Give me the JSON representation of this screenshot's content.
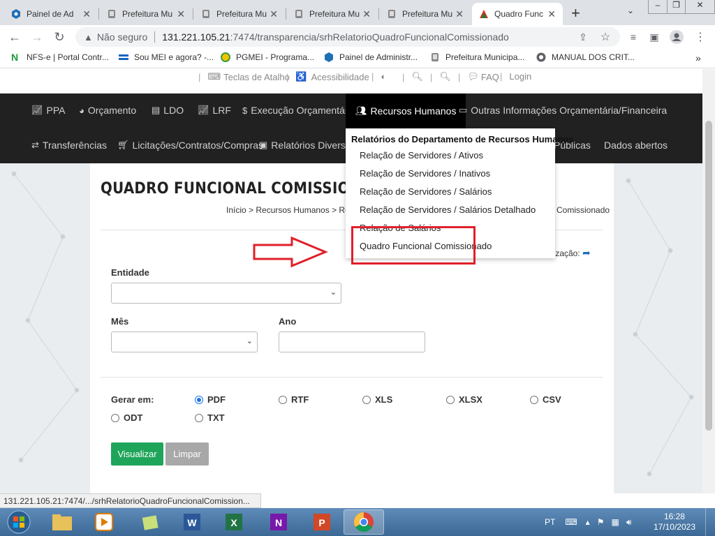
{
  "browser": {
    "tabs": [
      {
        "title": "Painel de Ad",
        "favicon": "painel-icon",
        "active": false
      },
      {
        "title": "Prefeitura Mu",
        "favicon": "prefeitura-icon",
        "active": false
      },
      {
        "title": "Prefeitura Mu",
        "favicon": "prefeitura-icon",
        "active": false
      },
      {
        "title": "Prefeitura Mu",
        "favicon": "prefeitura-icon",
        "active": false
      },
      {
        "title": "Prefeitura Mu",
        "favicon": "prefeitura-icon",
        "active": false
      },
      {
        "title": "Quadro Func",
        "favicon": "quadro-icon",
        "active": true
      }
    ],
    "new_tab_symbol": "+",
    "security_label": "Não seguro",
    "url_host": "131.221.105.21",
    "url_rest": ":7474/transparencia/srhRelatorioQuadroFuncionalComissionado",
    "bookmarks": [
      {
        "label": "NFS-e | Portal Contr...",
        "icon": "nfse-icon"
      },
      {
        "label": "Sou MEI e agora? -...",
        "icon": "mei-icon"
      },
      {
        "label": "PGMEI - Programa...",
        "icon": "pgmei-icon"
      },
      {
        "label": "Painel de Administr...",
        "icon": "painel-icon"
      },
      {
        "label": "Prefeitura Municipa...",
        "icon": "prefeitura-icon"
      },
      {
        "label": "MANUAL DOS CRIT...",
        "icon": "globe-icon"
      }
    ],
    "bookmarks_more": "»"
  },
  "site": {
    "topbar": {
      "shortcuts": "Teclas de Atalho",
      "accessibility": "Acessibilidade",
      "faq": "FAQ",
      "login": "Login"
    },
    "nav_row1": [
      {
        "label": "PPA",
        "icon": "chart-line-icon"
      },
      {
        "label": "Orçamento",
        "icon": "pie-chart-icon"
      },
      {
        "label": "LDO",
        "icon": "file-icon"
      },
      {
        "label": "LRF",
        "icon": "chart-line-icon"
      },
      {
        "label": "Execução Orçamentária",
        "icon": "dollar-icon"
      },
      {
        "label": "Recursos Humanos",
        "icon": "users-icon",
        "active": true
      },
      {
        "label": "Outras Informações Orçamentária/Financeira",
        "icon": "money-icon"
      }
    ],
    "nav_row2": [
      {
        "label": "Transferências",
        "icon": "exchange-icon"
      },
      {
        "label": "Licitações/Contratos/Compras",
        "icon": "cart-icon"
      },
      {
        "label": "Relatórios Diversos",
        "icon": "id-card-icon"
      },
      {
        "label": "Públicas",
        "icon": ""
      },
      {
        "label": "Dados abertos",
        "icon": ""
      }
    ],
    "dropdown": {
      "header": "Relatórios do Departamento de Recursos Humanos",
      "items": [
        "Relação de Servidores / Ativos",
        "Relação de Servidores / Inativos",
        "Relação de Servidores / Salários",
        "Relação de Servidores / Salários Detalhado",
        "Relação de Salários",
        "Quadro Funcional Comissionado"
      ]
    },
    "page_title": "QUADRO FUNCIONAL COMISSIONADO",
    "breadcrumb_left": "Início > Recursos Humanos > Relatór",
    "breadcrumb_right": "Comissionado",
    "update_label": "lização:",
    "form": {
      "entidade_label": "Entidade",
      "entidade_value": "",
      "mes_label": "Mês",
      "mes_value": "",
      "ano_label": "Ano",
      "ano_value": "",
      "gerar_label": "Gerar em:",
      "formats": [
        {
          "label": "PDF",
          "checked": true
        },
        {
          "label": "RTF",
          "checked": false
        },
        {
          "label": "XLS",
          "checked": false
        },
        {
          "label": "XLSX",
          "checked": false
        },
        {
          "label": "CSV",
          "checked": false
        },
        {
          "label": "ODT",
          "checked": false
        },
        {
          "label": "TXT",
          "checked": false
        }
      ],
      "submit_label": "Visualizar",
      "clear_label": "Limpar"
    }
  },
  "status_url": "131.221.105.21:7474/.../srhRelatorioQuadroFuncionalComission...",
  "taskbar": {
    "language": "PT",
    "time": "16:28",
    "date": "17/10/2023"
  },
  "colors": {
    "nav_bg": "#212121",
    "nav_active_bg": "#000000",
    "highlight_red": "#e0202a",
    "btn_submit": "#1fa55a",
    "btn_clear": "#a8a8a8"
  }
}
